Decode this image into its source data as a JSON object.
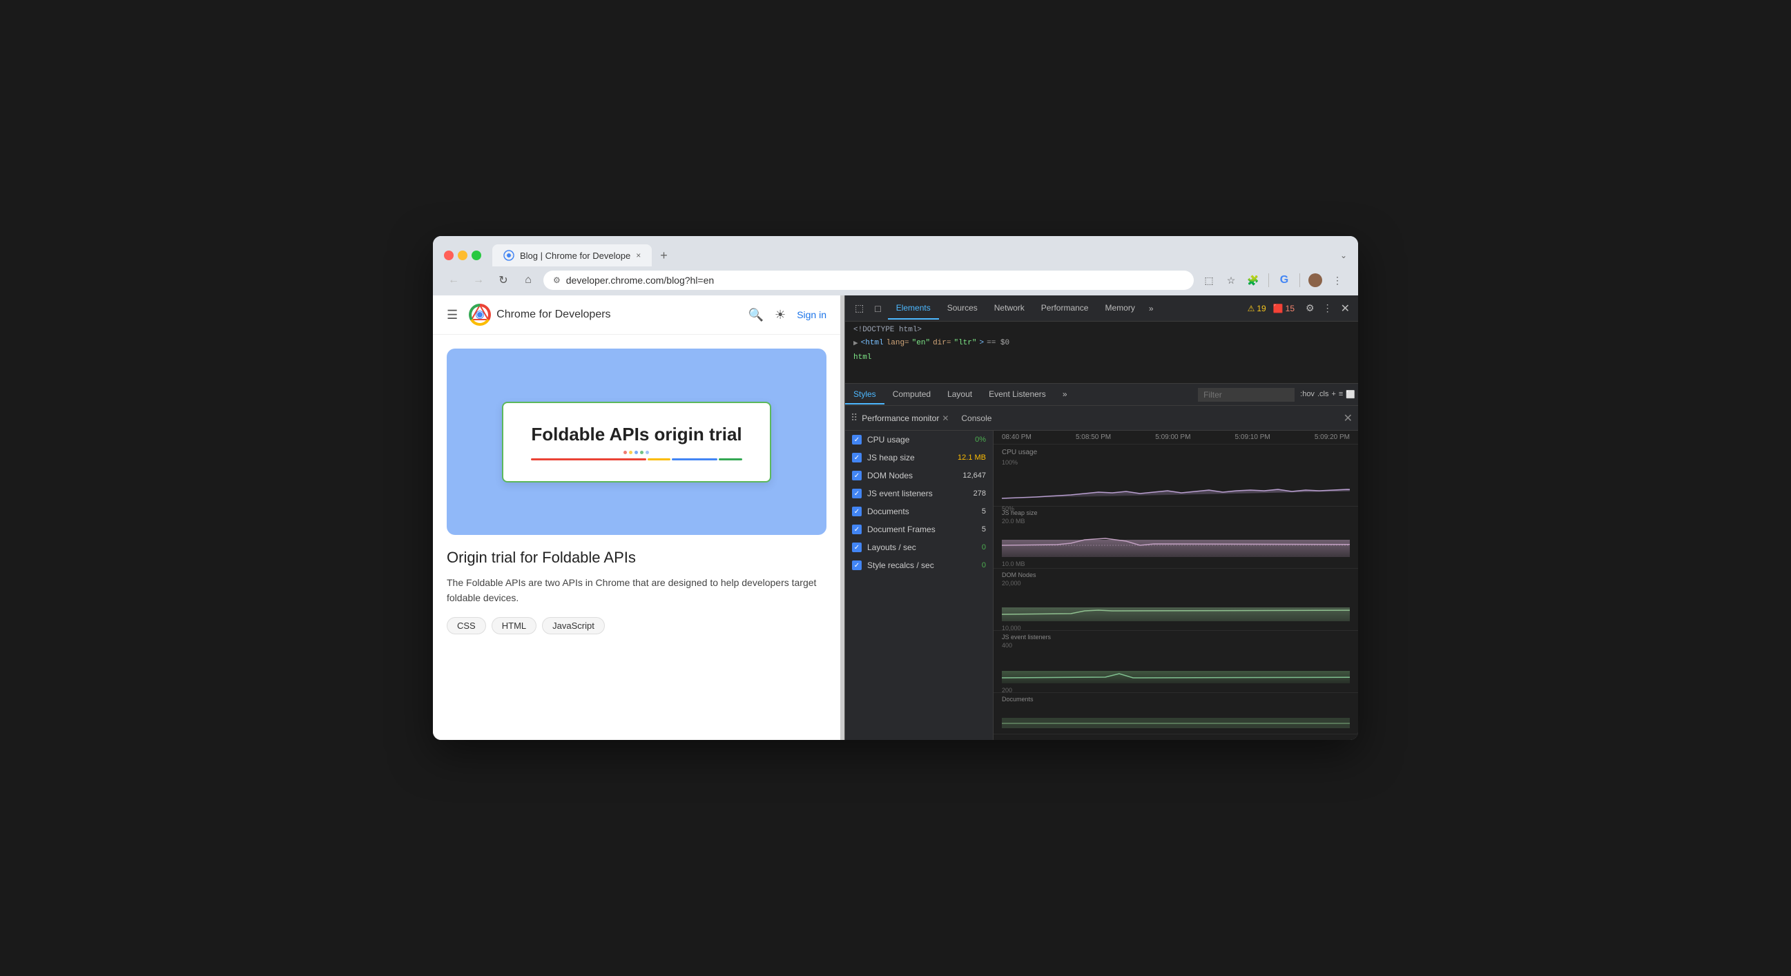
{
  "window": {
    "title": "Blog | Chrome for Developers"
  },
  "tab": {
    "label": "Blog | Chrome for Develope",
    "close_icon": "×",
    "new_tab_icon": "+"
  },
  "address_bar": {
    "url": "developer.chrome.com/blog?hl=en",
    "security_icon": "🔒"
  },
  "nav_buttons": {
    "back": "←",
    "forward": "→",
    "refresh": "↻",
    "home": "⌂",
    "dropdown": "⌄"
  },
  "page": {
    "site_title": "Chrome for Developers",
    "hero": {
      "title": "Foldable APIs origin trial"
    },
    "article": {
      "heading": "Origin trial for Foldable APIs",
      "description": "The Foldable APIs are two APIs in Chrome that are designed to help developers target foldable devices.",
      "tags": [
        "CSS",
        "HTML",
        "JavaScript"
      ]
    },
    "nav": {
      "signin": "Sign in"
    }
  },
  "devtools": {
    "tabs": [
      "Elements",
      "Sources",
      "Network",
      "Performance",
      "Memory"
    ],
    "active_tab": "Elements",
    "more_tabs": "»",
    "warnings": "19",
    "errors": "15",
    "html_doctype": "<!DOCTYPE html>",
    "html_tag": "<html lang=\"en\" dir=\"ltr\"> == $0",
    "breadcrumb": "html",
    "sub_tabs": [
      "Styles",
      "Computed",
      "Layout",
      "Event Listeners"
    ],
    "active_sub_tab": "Styles",
    "filter_placeholder": "Filter",
    "filter_tools": [
      ":hov",
      ".cls",
      "+"
    ],
    "perf_monitor": {
      "title": "Performance monitor",
      "console_tab": "Console",
      "metrics": [
        {
          "label": "CPU usage",
          "value": "0%",
          "color": "green"
        },
        {
          "label": "JS heap size",
          "value": "12.1 MB",
          "color": "yellow"
        },
        {
          "label": "DOM Nodes",
          "value": "12,647",
          "color": "normal"
        },
        {
          "label": "JS event listeners",
          "value": "278",
          "color": "normal"
        },
        {
          "label": "Documents",
          "value": "5",
          "color": "normal"
        },
        {
          "label": "Document Frames",
          "value": "5",
          "color": "normal"
        },
        {
          "label": "Layouts / sec",
          "value": "0",
          "color": "green"
        },
        {
          "label": "Style recalcs / sec",
          "value": "0",
          "color": "green"
        }
      ],
      "time_labels": [
        "08:40 PM",
        "5:08:50 PM",
        "5:09:00 PM",
        "5:09:10 PM",
        "5:09:20 PM"
      ],
      "chart_sections": [
        {
          "label": "CPU usage",
          "sublabel": "100%",
          "sublabel2": "50%",
          "color": "rgba(200,180,220,0.6)",
          "stroke": "#b89ecf"
        },
        {
          "label": "JS heap size",
          "sublabel": "20.0 MB",
          "sublabel2": "10.0 MB",
          "color": "rgba(200,180,220,0.4)",
          "stroke": "#c09fc0"
        },
        {
          "label": "DOM Nodes",
          "sublabel": "20,000",
          "sublabel2": "10,000",
          "color": "rgba(180,210,180,0.4)",
          "stroke": "#90c090"
        },
        {
          "label": "JS event listeners",
          "sublabel": "400",
          "sublabel2": "200",
          "color": "rgba(180,210,180,0.3)",
          "stroke": "#80b080"
        },
        {
          "label": "Documents",
          "sublabel": "",
          "sublabel2": "",
          "color": "rgba(180,210,180,0.3)",
          "stroke": "#80b080"
        }
      ]
    }
  }
}
